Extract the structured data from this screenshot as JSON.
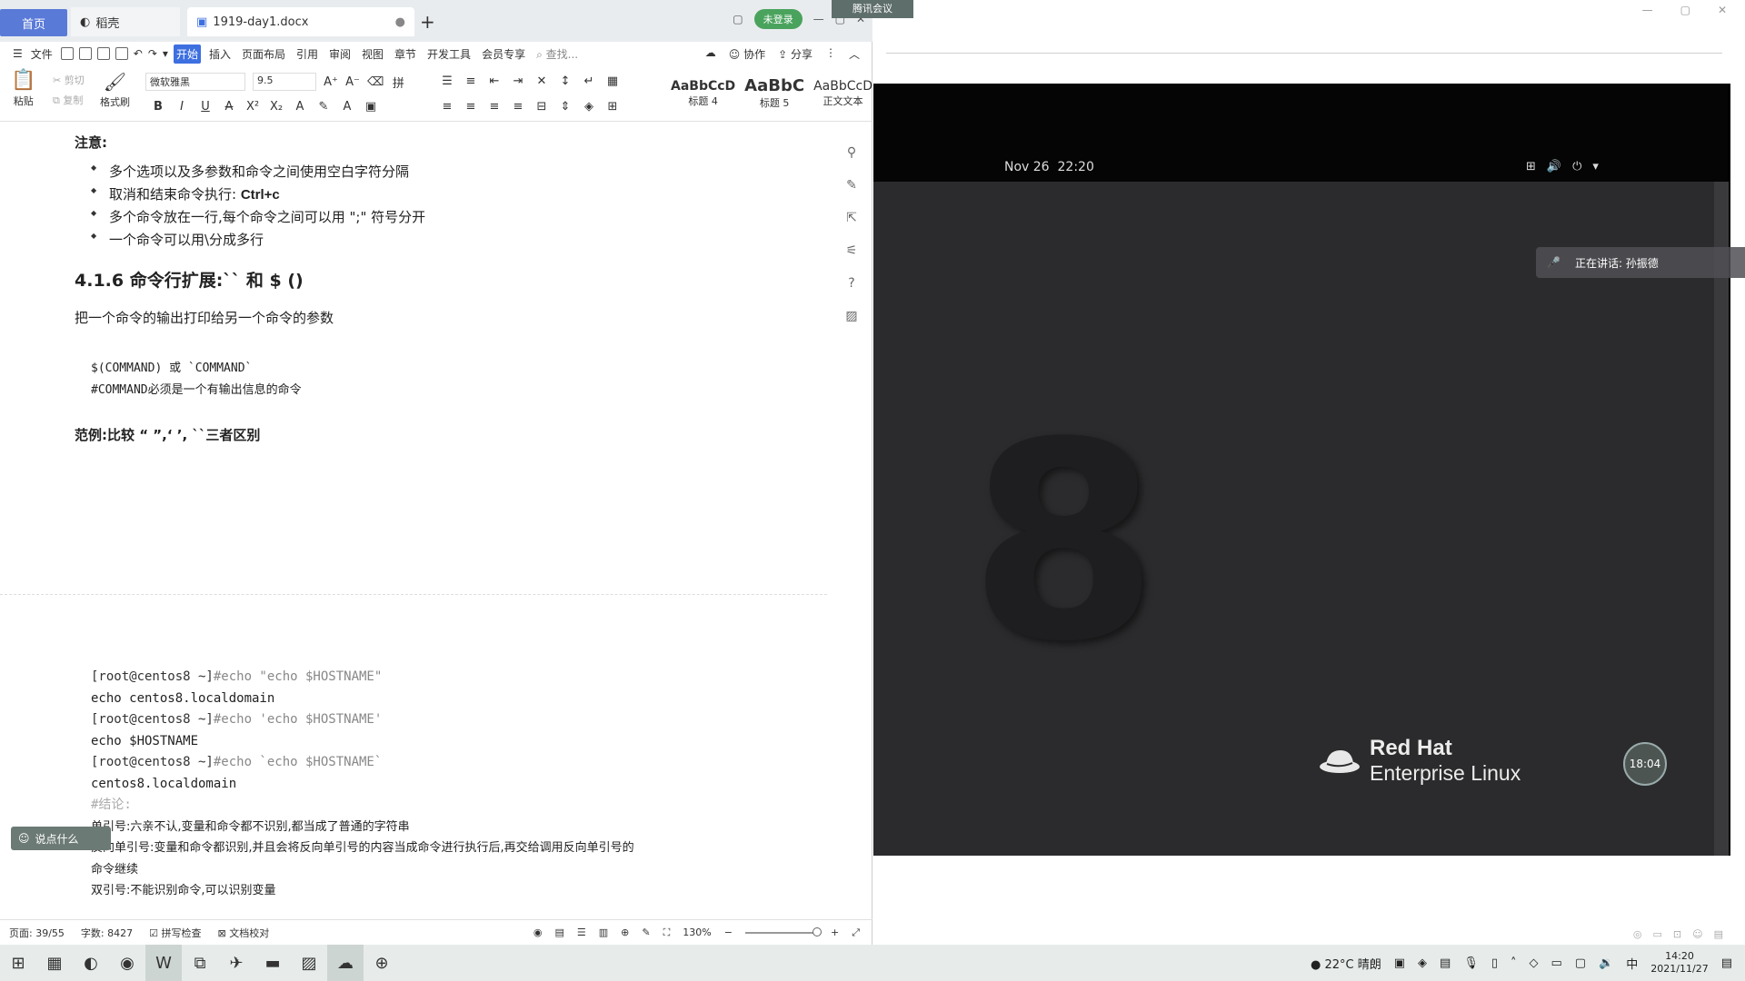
{
  "tabs": {
    "home": "首页",
    "daoke": "稻壳",
    "doc": "1919-day1.docx",
    "add": "+"
  },
  "titlebar_right": {
    "login": "未登录"
  },
  "menu": {
    "file": "文件",
    "start": "开始",
    "insert": "插入",
    "layout": "页面布局",
    "reference": "引用",
    "review": "审阅",
    "view": "视图",
    "section": "章节",
    "devtools": "开发工具",
    "member": "会员专享",
    "search": "查找...",
    "collab": "协作",
    "share": "分享"
  },
  "ribbon": {
    "paste": "粘贴",
    "cut": "剪切",
    "copy": "复制",
    "format_painter": "格式刷",
    "font": "微软雅黑",
    "size": "9.5",
    "styles": [
      {
        "preview": "AaBbCcD",
        "name": "标题 4"
      },
      {
        "preview": "AaBbC",
        "name": "标题 5"
      },
      {
        "preview": "AaBbCcD",
        "name": "正文文本"
      }
    ]
  },
  "doc": {
    "note_title": "注意:",
    "bullets": [
      {
        "text": "多个选项以及多参数和命令之间使用空白字符分隔",
        "bold": ""
      },
      {
        "text": "取消和结束命令执行:",
        "bold": "Ctrl+c"
      },
      {
        "text": "多个命令放在一行,每个命令之间可以用 \";\" 符号分开",
        "bold": ""
      },
      {
        "text": "一个命令可以用\\分成多行",
        "bold": ""
      }
    ],
    "heading": "4.1.6 命令行扩展:`` 和 $ ()",
    "para": "把一个命令的输出打印给另一个命令的参数",
    "code1": "$(COMMAND) 或 `COMMAND`",
    "code2": "#COMMAND必须是一个有输出信息的命令",
    "example_title": "范例:比较 “ ”,‘ ’, ``三者区别",
    "terminal": [
      {
        "prompt": "[root@centos8 ~]",
        "cmd": "#echo \"echo $HOSTNAME\""
      },
      {
        "out": "echo centos8.localdomain"
      },
      {
        "prompt": "[root@centos8 ~]",
        "cmd": "#echo 'echo $HOSTNAME'"
      },
      {
        "out": "echo $HOSTNAME"
      },
      {
        "prompt": "[root@centos8 ~]",
        "cmd": "#echo `echo $HOSTNAME`"
      },
      {
        "out": "centos8.localdomain"
      },
      {
        "comment": "#结论:"
      },
      {
        "cjk": "单引号:六亲不认,变量和命令都不识别,都当成了普通的字符串"
      },
      {
        "cjk": "反向单引号:变量和命令都识别,并且会将反向单引号的内容当成命令进行执行后,再交给调用反向单引号的"
      },
      {
        "cjk": "命令继续"
      },
      {
        "cjk": "双引号:不能识别命令,可以识别变量"
      }
    ]
  },
  "chat_pill": "说点什么",
  "status": {
    "page": "页面: 39/55",
    "words": "字数: 8427",
    "spell": "拼写检查",
    "proof": "文档校对",
    "zoom": "130%"
  },
  "vm": {
    "meeting": "腾讯会议",
    "date": "Nov 26",
    "time": "22:20",
    "big_digit": "8",
    "brand1": "Red Hat",
    "brand2": "Enterprise Linux",
    "speaking": "正在讲话: 孙振德",
    "timer": "18:04"
  },
  "taskbar": {
    "weather": "22°C 晴朗",
    "ime": "中",
    "time": "14:20",
    "date": "2021/11/27"
  }
}
